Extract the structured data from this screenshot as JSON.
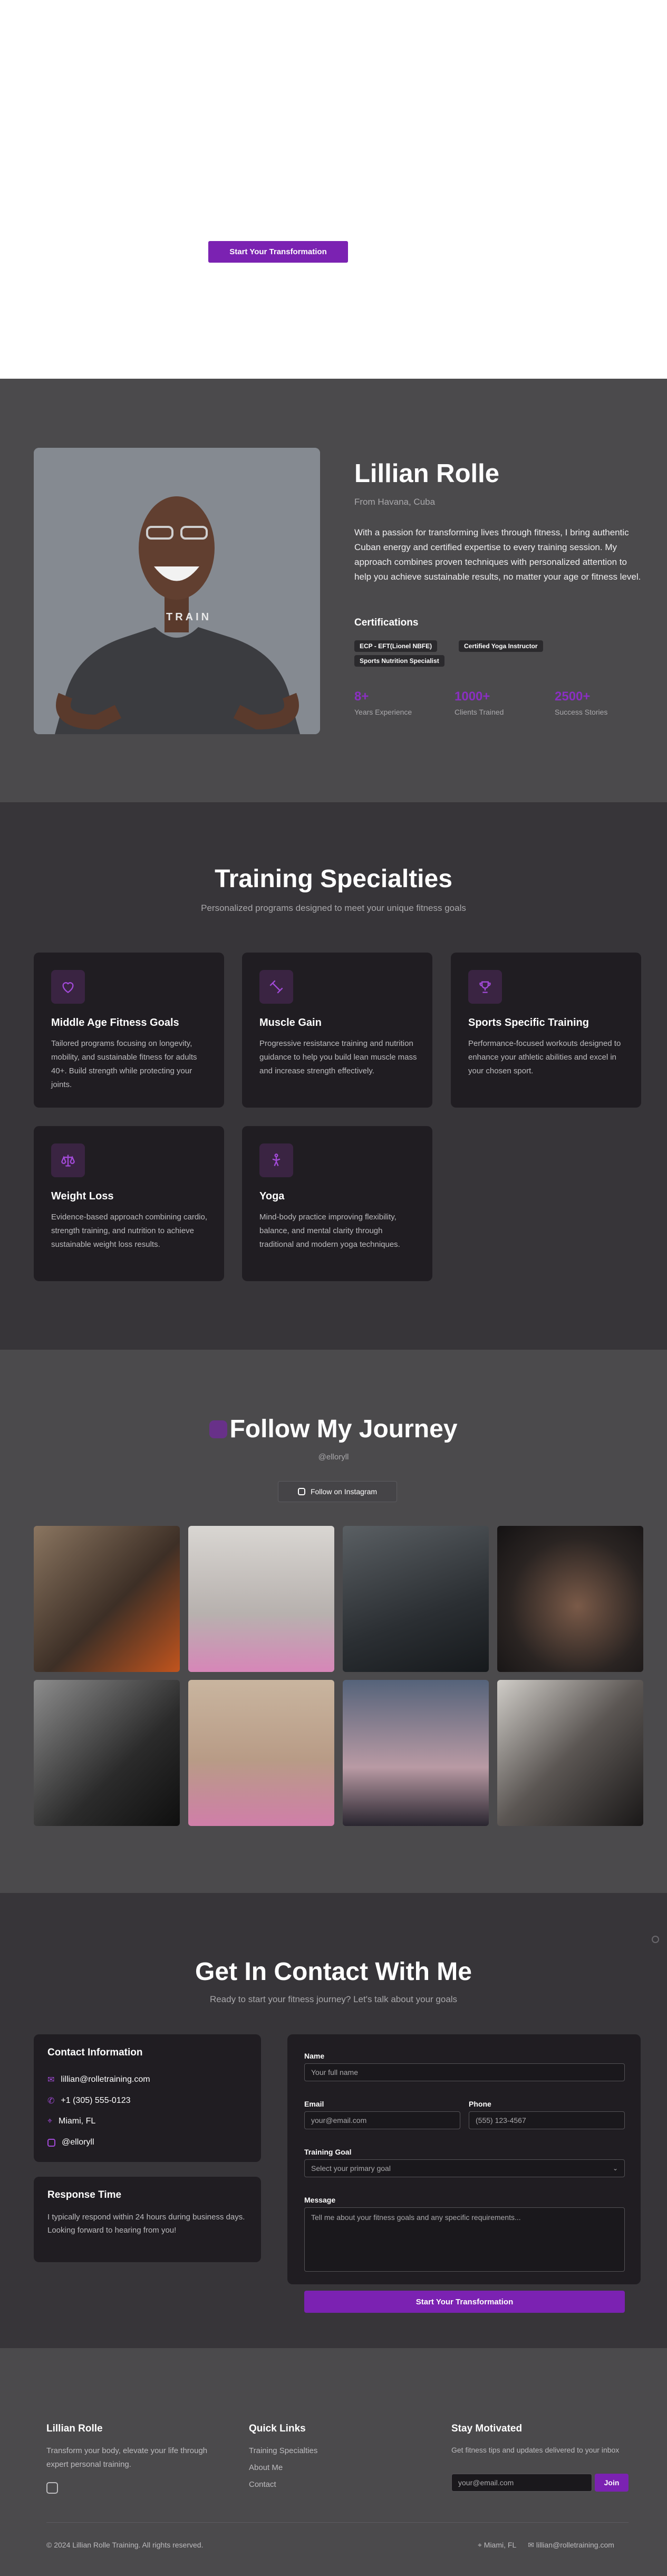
{
  "hero": {
    "cta_label": "Start Your Transformation"
  },
  "about": {
    "name": "Lillian Rolle",
    "origin": "From Havana, Cuba",
    "bio": "With a passion for transforming lives through fitness, I bring authentic Cuban energy and certified expertise to every training session. My approach combines proven techniques with personalized attention to help you achieve sustainable results, no matter your age or fitness level.",
    "shirt_text": "TRAIN",
    "certifications_heading": "Certifications",
    "certifications": [
      "ECP - EFT(Lionel NBFE)",
      "Certified Yoga Instructor",
      "Sports Nutrition Specialist"
    ],
    "stats": [
      {
        "value": "8+",
        "label": "Years Experience"
      },
      {
        "value": "1000+",
        "label": "Clients Trained"
      },
      {
        "value": "2500+",
        "label": "Success Stories"
      }
    ]
  },
  "specialties": {
    "title": "Training Specialties",
    "subtitle": "Personalized programs designed to meet your unique fitness goals",
    "items": [
      {
        "icon": "heart-icon",
        "title": "Middle Age Fitness Goals",
        "desc": "Tailored programs focusing on longevity, mobility, and sustainable fitness for adults 40+. Build strength while protecting your joints."
      },
      {
        "icon": "dumbbell-icon",
        "title": "Muscle Gain",
        "desc": "Progressive resistance training and nutrition guidance to help you build lean muscle mass and increase strength effectively."
      },
      {
        "icon": "trophy-icon",
        "title": "Sports Specific Training",
        "desc": "Performance-focused workouts designed to enhance your athletic abilities and excel in your chosen sport."
      },
      {
        "icon": "scale-icon",
        "title": "Weight Loss",
        "desc": "Evidence-based approach combining cardio, strength training, and nutrition to achieve sustainable weight loss results."
      },
      {
        "icon": "yoga-icon",
        "title": "Yoga",
        "desc": "Mind-body practice improving flexibility, balance, and mental clarity through traditional and modern yoga techniques."
      }
    ]
  },
  "journey": {
    "title": "Follow My Journey",
    "handle": "@elloryll",
    "button": "Follow on Instagram"
  },
  "contact": {
    "title": "Get In Contact With Me",
    "subtitle": "Ready to start your fitness journey? Let's talk about your goals",
    "info_heading": "Contact Information",
    "email": "lillian@rolletraining.com",
    "phone": "+1 (305) 555-0123",
    "location": "Miami, FL",
    "instagram": "@elloryll",
    "response_heading": "Response Time",
    "response_text": "I typically respond within 24 hours during business days. Looking forward to hearing from you!",
    "form": {
      "name_label": "Name",
      "name_placeholder": "Your full name",
      "email_label": "Email",
      "email_placeholder": "your@email.com",
      "phone_label": "Phone",
      "phone_placeholder": "(555) 123-4567",
      "goal_label": "Training Goal",
      "goal_selected": "Select your primary goal",
      "message_label": "Message",
      "message_placeholder": "Tell me about your fitness goals and any specific requirements...",
      "submit": "Start Your Transformation"
    }
  },
  "footer": {
    "brand": "Lillian Rolle",
    "tagline": "Transform your body, elevate your life through expert personal training.",
    "links_heading": "Quick Links",
    "links": [
      "Training Specialties",
      "About Me",
      "Contact"
    ],
    "newsletter_heading": "Stay Motivated",
    "newsletter_text": "Get fitness tips and updates delivered to your inbox",
    "newsletter_placeholder": "your@email.com",
    "newsletter_button": "Join",
    "copyright": "© 2024 Lillian Rolle Training. All rights reserved.",
    "location": "Miami, FL",
    "email": "lillian@rolletraining.com"
  },
  "colors": {
    "accent": "#7b22b2",
    "dark": "#201d22",
    "section_gray": "#4b4a4c",
    "section_dark": "#373539"
  }
}
